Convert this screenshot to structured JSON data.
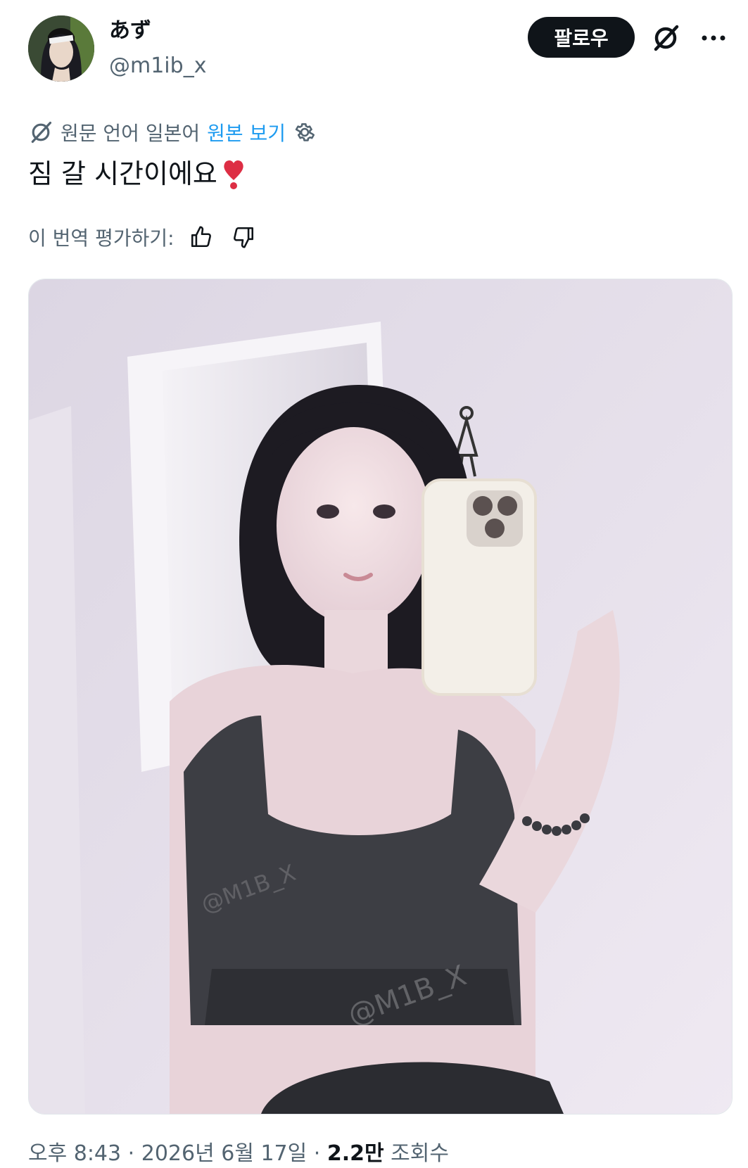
{
  "user": {
    "display_name": "あず",
    "handle": "@m1ib_x",
    "avatar_icon": "avatar-image"
  },
  "header": {
    "follow_label": "팔로우",
    "grok_icon": "grok-icon",
    "more_icon": "more-icon"
  },
  "translation": {
    "icon": "translate-icon",
    "source_lang_text": "원문 언어 일본어",
    "view_original_label": "원본 보기",
    "settings_icon": "gear-icon"
  },
  "tweet": {
    "text": "짐 갈 시간이에요",
    "emoji": "❣️"
  },
  "rating": {
    "label": "이 번역 평가하기:",
    "thumbs_up_icon": "thumbs-up-icon",
    "thumbs_down_icon": "thumbs-down-icon"
  },
  "media": {
    "watermark": "@M1B_X"
  },
  "meta": {
    "time": "오후 8:43",
    "separator": "·",
    "date": "2026년 6월 17일",
    "views_count": "2.2만",
    "views_label": "조회수"
  },
  "colors": {
    "text": "#0f1419",
    "secondary": "#536471",
    "link": "#1d9bf0",
    "follow_bg": "#0f1419"
  }
}
